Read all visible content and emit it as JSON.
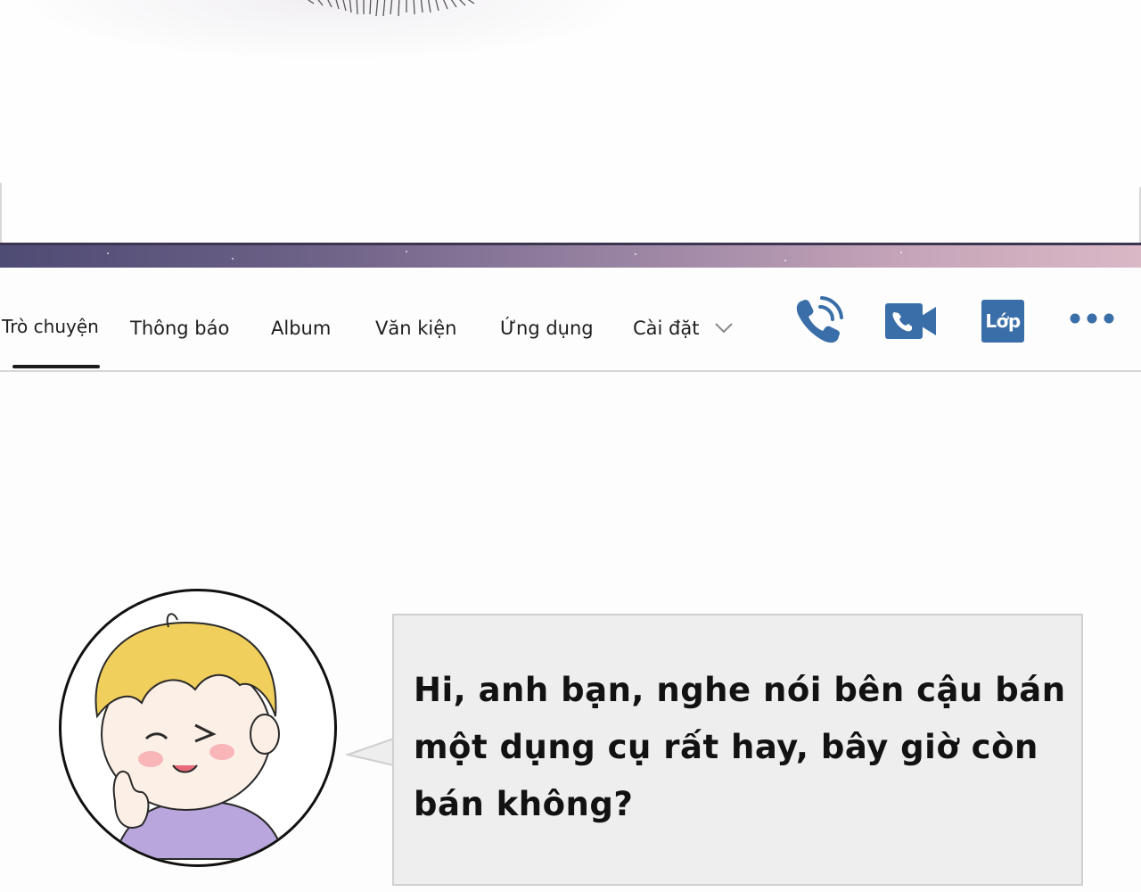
{
  "nav": {
    "tabs": [
      {
        "label": "Trò chuyện",
        "active": true
      },
      {
        "label": "Thông báo"
      },
      {
        "label": "Album"
      },
      {
        "label": "Văn kiện"
      },
      {
        "label": "Ứng dụng"
      },
      {
        "label": "Cài đặt"
      }
    ],
    "actions": {
      "voice_call_icon": "phone-call-icon",
      "video_call_icon": "video-call-icon",
      "class_label": "Lớp",
      "more_icon": "more-dots-icon"
    },
    "accent_color": "#3a6ea8"
  },
  "chat": {
    "message": {
      "text": "Hi, anh bạn, nghe nói bên cậu bán một dụng cụ rất hay, bây giờ còn bán không?"
    },
    "avatar_icon": "avatar-icon"
  }
}
